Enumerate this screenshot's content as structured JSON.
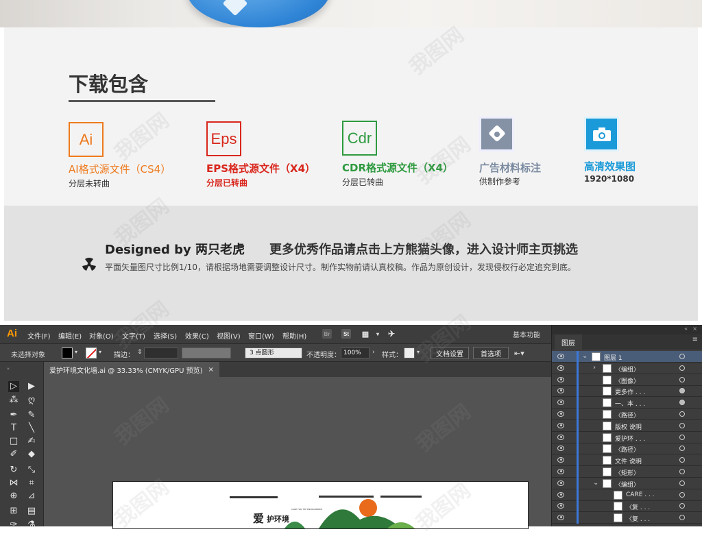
{
  "download": {
    "title": "下载包含",
    "formats": [
      {
        "icon": "Ai",
        "name": "AI格式源文件（CS4）",
        "sub": "分层未转曲",
        "color": "#ee7a1d"
      },
      {
        "icon": "Eps",
        "name": "EPS格式源文件（X4）",
        "sub": "分层已转曲",
        "color": "#d9261c"
      },
      {
        "icon": "Cdr",
        "name": "CDR格式源文件（X4）",
        "sub": "分层已转曲",
        "color": "#2e9a3f"
      },
      {
        "icon": "tag-icon",
        "name": "广告材料标注",
        "sub": "供制作参考",
        "color": "#7a8aa0"
      },
      {
        "icon": "camera-icon",
        "name": "高清效果图",
        "sub": "1920*1080",
        "color": "#1a9ad8"
      }
    ]
  },
  "designed": {
    "by": "Designed by 两只老虎",
    "more": "更多优秀作品请点击上方熊猫头像，进入设计师主页挑选",
    "note": "平面矢量图尺寸比例1/10，请根据场地需要调整设计尺寸。制作实物前请认真校稿。作品为原创设计，发现侵权行必定追究到底。"
  },
  "ai": {
    "logo": "Ai",
    "menus": [
      "文件(F)",
      "编辑(E)",
      "对象(O)",
      "文字(T)",
      "选择(S)",
      "效果(C)",
      "视图(V)",
      "窗口(W)",
      "帮助(H)"
    ],
    "bridge": "Br",
    "stock": "St",
    "workspace": "基本功能",
    "control": {
      "no_selection": "未选择对象",
      "stroke_label": "描边：",
      "brush": "3 点圆形",
      "opacity_label": "不透明度：",
      "opacity_value": "100%",
      "style_label": "样式：",
      "doc_setup": "文档设置",
      "prefs": "首选项"
    },
    "doc_tab": "爱护环境文化墙.ai @ 33.33% (CMYK/GPU 预览)",
    "doc_tab_close": "×",
    "layers_tab": "图层",
    "layers": [
      {
        "name": "图层 1",
        "indent": 0,
        "expanded": true
      },
      {
        "name": "〈编组〉",
        "indent": 1,
        "expanded": false
      },
      {
        "name": "〈图像〉",
        "indent": 1
      },
      {
        "name": "更多作 . . .",
        "indent": 1
      },
      {
        "name": "一、本 . . .",
        "indent": 1
      },
      {
        "name": "〈路径〉",
        "indent": 1
      },
      {
        "name": "版权 说明",
        "indent": 1
      },
      {
        "name": "爱护环 . . .",
        "indent": 1
      },
      {
        "name": "〈路径〉",
        "indent": 1
      },
      {
        "name": "文件 说明",
        "indent": 1
      },
      {
        "name": "〈矩形〉",
        "indent": 1
      },
      {
        "name": "〈编组〉",
        "indent": 1,
        "expanded": true
      },
      {
        "name": "CARE . . .",
        "indent": 2
      },
      {
        "name": "〈复 . . .",
        "indent": 2
      },
      {
        "name": "〈复 . . .",
        "indent": 2
      }
    ],
    "artboard": {
      "headline_1": "爱",
      "headline_2": "护环境",
      "subtitle": "CARE FOR THE ENVIRONMENT"
    }
  },
  "watermark": "我图网"
}
